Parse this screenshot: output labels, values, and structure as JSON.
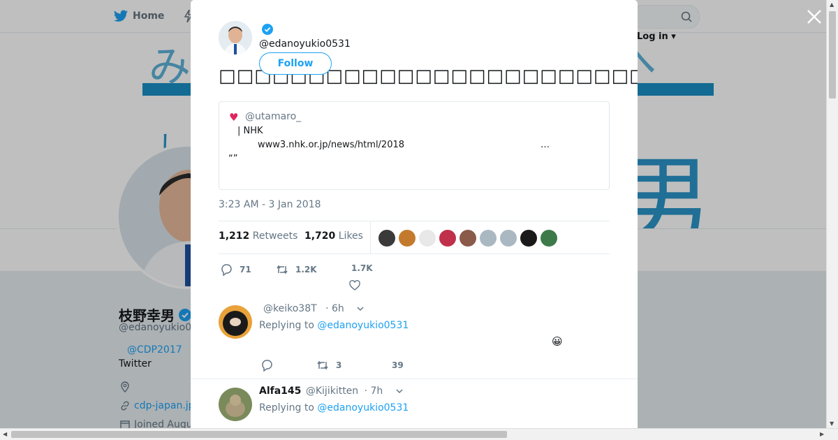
{
  "topbar": {
    "home_label": "Home",
    "login_label": "Log in"
  },
  "profile": {
    "name": "枝野幸男",
    "handle": "@edanoyukio0",
    "link1": "@CDP2017",
    "bio2": "Twitter",
    "url": "cdp-japan.jp",
    "joined": "Joined Augu"
  },
  "banner": {
    "k1": "み",
    "k2": "へ",
    "k3": "男",
    "k4": "し"
  },
  "tweet": {
    "handle": "@edanoyukio0531",
    "follow_label": "Follow",
    "text": "□□□□□□□□□□□□□□□□□□□□□□□□□□□□□□□□□□□□□□□□□□□□□□□□□□□□",
    "quote": {
      "heart": "♥",
      "user": "@utamaro_",
      "line1": "| NHK",
      "line2": "www3.nhk.or.jp/news/html/2018",
      "ellipsis": "…",
      "line3": "“”"
    },
    "timestamp": "3:23 AM - 3 Jan 2018",
    "retweets_count": "1,212",
    "retweets_label": "Retweets",
    "likes_count": "1,720",
    "likes_label": "Likes",
    "likers": [
      "#3a3a3a",
      "#c47a2c",
      "#e8e8e8",
      "#c0304a",
      "#8a5a4a",
      "#aab8c2",
      "#aab8c2",
      "#1a1a1a",
      "#3d7a4a"
    ],
    "actions": {
      "replies": "71",
      "retweets": "1.2K",
      "likes": "1.7K"
    }
  },
  "replies": [
    {
      "display_name": "",
      "handle": "@keiko38T",
      "time": "· 6h",
      "replying_label": "Replying to",
      "replying_handle": "@edanoyukio0531",
      "emoji": "😀",
      "actions": {
        "replies": "",
        "retweets": "3",
        "likes": "39"
      }
    },
    {
      "display_name": "Alfa145",
      "handle": "@Kijikitten",
      "time": "· 7h",
      "replying_label": "Replying to",
      "replying_handle": "@edanoyukio0531"
    }
  ]
}
